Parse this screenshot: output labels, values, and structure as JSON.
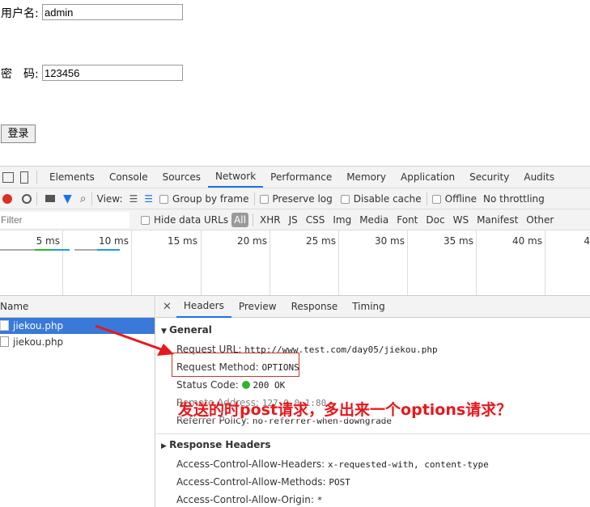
{
  "form": {
    "username_label": "用户名:",
    "username_value": "admin",
    "password_label": "密　码:",
    "password_value": "123456",
    "login_button": "登录"
  },
  "devtools": {
    "tabs": [
      "Elements",
      "Console",
      "Sources",
      "Network",
      "Performance",
      "Memory",
      "Application",
      "Security",
      "Audits"
    ],
    "active_tab": "Network",
    "toolbar": {
      "view_label": "View:",
      "group_by_frame": "Group by frame",
      "preserve_log": "Preserve log",
      "disable_cache": "Disable cache",
      "offline": "Offline",
      "throttling": "No throttling"
    },
    "filter": {
      "placeholder": "Filter",
      "hide_data_urls": "Hide data URLs",
      "types": [
        "All",
        "XHR",
        "JS",
        "CSS",
        "Img",
        "Media",
        "Font",
        "Doc",
        "WS",
        "Manifest",
        "Other"
      ]
    },
    "timeline_ticks": [
      "5 ms",
      "10 ms",
      "15 ms",
      "20 ms",
      "25 ms",
      "30 ms",
      "35 ms",
      "40 ms",
      "4"
    ],
    "list": {
      "header": "Name",
      "items": [
        "jiekou.php",
        "jiekou.php"
      ]
    },
    "detail_tabs": [
      "Headers",
      "Preview",
      "Response",
      "Timing"
    ],
    "general": {
      "title": "General",
      "request_url_label": "Request URL:",
      "request_url": "http://www.test.com/day05/jiekou.php",
      "request_method_label": "Request Method:",
      "request_method": "OPTIONS",
      "status_code_label": "Status Code:",
      "status_code": "200 OK",
      "remote_address_label": "Remote Address:",
      "remote_address": "127.0.0.1:80",
      "referrer_policy_label": "Referrer Policy:",
      "referrer_policy": "no-referrer-when-downgrade"
    },
    "response_headers": {
      "title": "Response Headers",
      "items": [
        {
          "k": "Access-Control-Allow-Headers:",
          "v": "x-requested-with, content-type"
        },
        {
          "k": "Access-Control-Allow-Methods:",
          "v": "POST"
        },
        {
          "k": "Access-Control-Allow-Origin:",
          "v": "*"
        }
      ]
    }
  },
  "annotation": "发送的时post请求，多出来一个options请求？",
  "colors": {
    "accent": "#1a73e8",
    "selected_row": "#3879d9",
    "annotation": "#e6191e",
    "record": "#d93025",
    "status_ok": "#2db52d"
  }
}
